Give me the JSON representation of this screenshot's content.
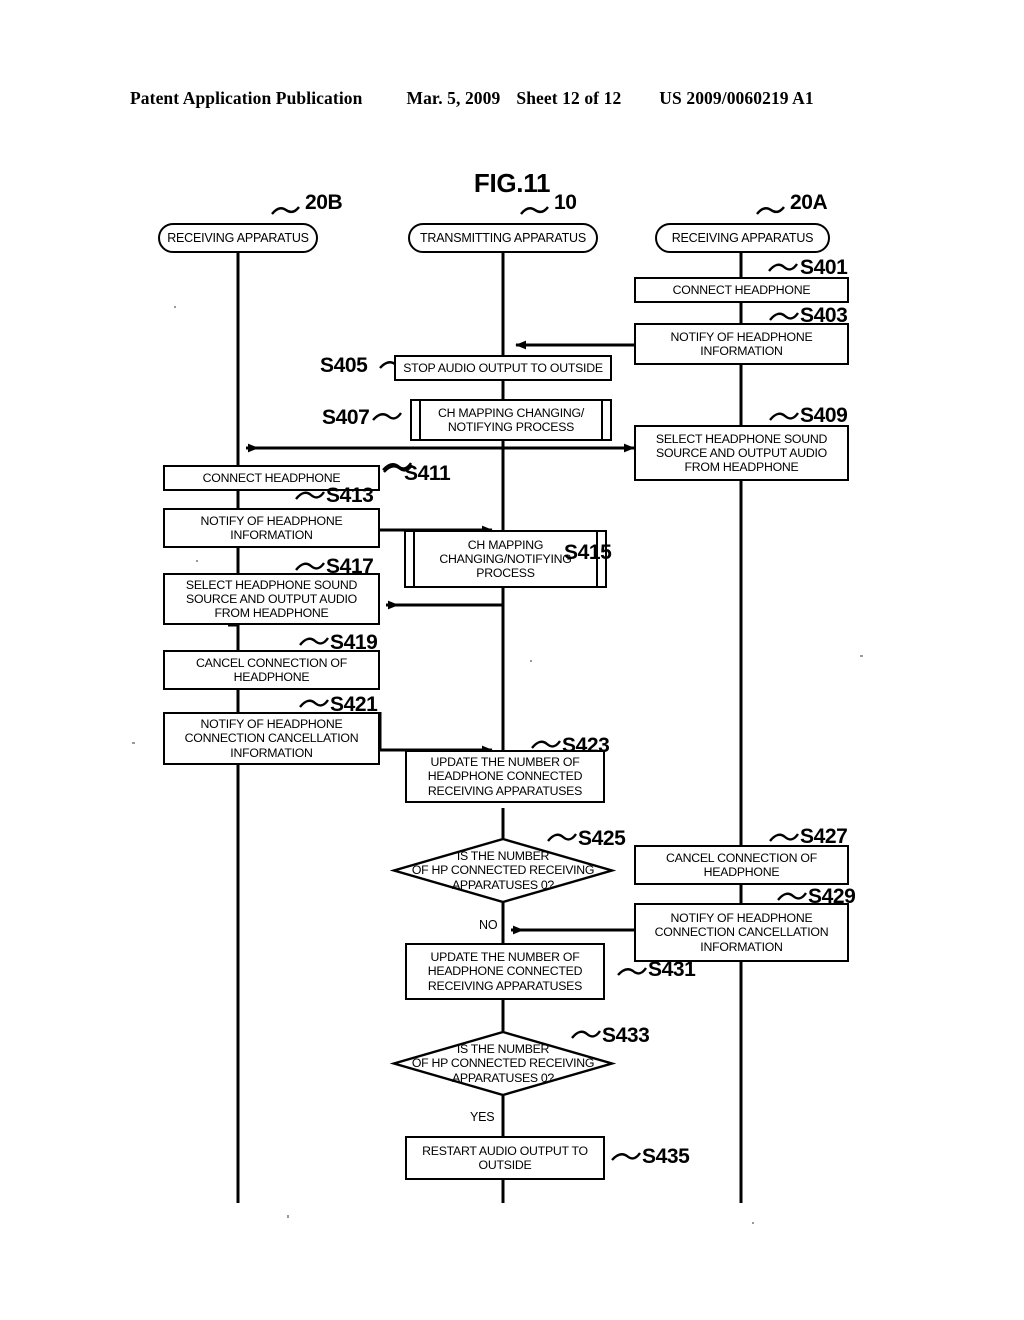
{
  "header": {
    "publication": "Patent Application Publication",
    "date": "Mar. 5, 2009",
    "sheet": "Sheet 12 of 12",
    "number": "US 2009/0060219 A1"
  },
  "figure": {
    "title": "FIG.11"
  },
  "lanes": [
    {
      "id": "lane-20b",
      "label": "RECEIVING APPARATUS",
      "ref": "20B"
    },
    {
      "id": "lane-10",
      "label": "TRANSMITTING APPARATUS",
      "ref": "10"
    },
    {
      "id": "lane-20a",
      "label": "RECEIVING APPARATUS",
      "ref": "20A"
    }
  ],
  "steps": [
    {
      "ref": "S401",
      "lane": "20A",
      "type": "process",
      "text": "CONNECT HEADPHONE"
    },
    {
      "ref": "S403",
      "lane": "20A",
      "type": "process",
      "text": "NOTIFY OF HEADPHONE INFORMATION",
      "line1": "NOTIFY OF HEADPHONE",
      "line2": "INFORMATION"
    },
    {
      "ref": "S405",
      "lane": "10",
      "type": "process",
      "text": "STOP AUDIO OUTPUT TO OUTSIDE"
    },
    {
      "ref": "S407",
      "lane": "10",
      "type": "predefined-process",
      "text": "CH MAPPING CHANGING/ NOTIFYING PROCESS",
      "line1": "CH MAPPING CHANGING/",
      "line2": "NOTIFYING PROCESS"
    },
    {
      "ref": "S409",
      "lane": "20A",
      "type": "process",
      "text": "SELECT HEADPHONE SOUND SOURCE AND OUTPUT AUDIO FROM HEADPHONE",
      "line1": "SELECT HEADPHONE SOUND",
      "line2": "SOURCE AND OUTPUT AUDIO",
      "line3": "FROM HEADPHONE"
    },
    {
      "ref": "S411",
      "lane": "20B",
      "type": "process",
      "text": "CONNECT HEADPHONE"
    },
    {
      "ref": "S413",
      "lane": "20B",
      "type": "process",
      "text": "NOTIFY OF HEADPHONE INFORMATION",
      "line1": "NOTIFY OF HEADPHONE",
      "line2": "INFORMATION"
    },
    {
      "ref": "S415",
      "lane": "10",
      "type": "predefined-process",
      "text": "CH MAPPING CHANGING/NOTIFYING PROCESS",
      "line1": "CH MAPPING",
      "line2": "CHANGING/NOTIFYING",
      "line3": "PROCESS"
    },
    {
      "ref": "S417",
      "lane": "20B",
      "type": "process",
      "text": "SELECT HEADPHONE SOUND SOURCE AND OUTPUT AUDIO FROM HEADPHONE",
      "line1": "SELECT HEADPHONE SOUND",
      "line2": "SOURCE AND OUTPUT AUDIO",
      "line3": "FROM HEADPHONE"
    },
    {
      "ref": "S419",
      "lane": "20B",
      "type": "process",
      "text": "CANCEL CONNECTION OF HEADPHONE",
      "line1": "CANCEL CONNECTION OF",
      "line2": "HEADPHONE"
    },
    {
      "ref": "S421",
      "lane": "20B",
      "type": "process",
      "text": "NOTIFY OF HEADPHONE CONNECTION CANCELLATION INFORMATION",
      "line1": "NOTIFY OF HEADPHONE",
      "line2": "CONNECTION CANCELLATION",
      "line3": "INFORMATION"
    },
    {
      "ref": "S423",
      "lane": "10",
      "type": "process",
      "text": "UPDATE THE NUMBER OF HEADPHONE CONNECTED RECEIVING APPARATUSES",
      "line1": "UPDATE THE NUMBER OF",
      "line2": "HEADPHONE CONNECTED",
      "line3": "RECEIVING APPARATUSES"
    },
    {
      "ref": "S425",
      "lane": "10",
      "type": "decision",
      "text": "IS THE NUMBER OF HP CONNECTED RECEIVING APPARATUSES 0?",
      "line1": "IS THE NUMBER",
      "line2": "OF HP CONNECTED RECEIVING",
      "line3": "APPARATUSES 0?",
      "branch": "NO"
    },
    {
      "ref": "S427",
      "lane": "20A",
      "type": "process",
      "text": "CANCEL CONNECTION OF HEADPHONE",
      "line1": "CANCEL CONNECTION OF",
      "line2": "HEADPHONE"
    },
    {
      "ref": "S429",
      "lane": "20A",
      "type": "process",
      "text": "NOTIFY OF HEADPHONE CONNECTION CANCELLATION INFORMATION",
      "line1": "NOTIFY OF HEADPHONE",
      "line2": "CONNECTION CANCELLATION",
      "line3": "INFORMATION"
    },
    {
      "ref": "S431",
      "lane": "10",
      "type": "process",
      "text": "UPDATE THE NUMBER OF HEADPHONE CONNECTED RECEIVING APPARATUSES",
      "line1": "UPDATE THE NUMBER OF",
      "line2": "HEADPHONE CONNECTED",
      "line3": "RECEIVING APPARATUSES"
    },
    {
      "ref": "S433",
      "lane": "10",
      "type": "decision",
      "text": "IS THE NUMBER OF HP CONNECTED RECEIVING APPARATUSES 0?",
      "line1": "IS THE NUMBER",
      "line2": "OF HP CONNECTED RECEIVING",
      "line3": "APPARATUSES 0?",
      "branch": "YES"
    },
    {
      "ref": "S435",
      "lane": "10",
      "type": "process",
      "text": "RESTART AUDIO OUTPUT TO OUTSIDE",
      "line1": "RESTART AUDIO OUTPUT TO",
      "line2": "OUTSIDE"
    }
  ],
  "branch_labels": {
    "no": "NO",
    "yes": "YES"
  },
  "colors": {
    "ink": "#000000",
    "paper": "#ffffff"
  }
}
